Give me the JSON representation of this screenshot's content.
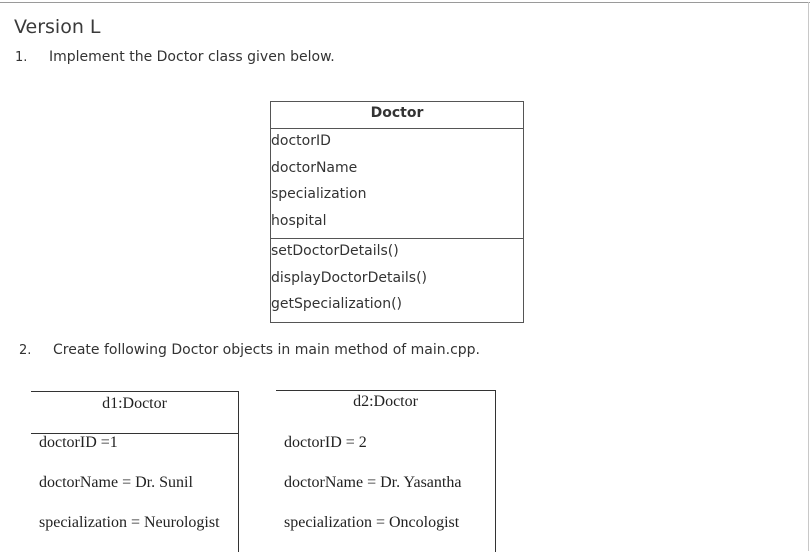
{
  "header": {
    "title": "Version L"
  },
  "questions": [
    {
      "number": "1.",
      "text": "Implement the Doctor class given below."
    },
    {
      "number": "2.",
      "text": "Create following Doctor objects in main method of main.cpp."
    }
  ],
  "uml_class": {
    "name": "Doctor",
    "attributes": [
      "doctorID",
      "doctorName",
      "specialization",
      "hospital"
    ],
    "methods": [
      "setDoctorDetails()",
      "displayDoctorDetails()",
      "getSpecialization()"
    ]
  },
  "objects": [
    {
      "title": "d1:Doctor",
      "fields": [
        "doctorID =1",
        "doctorName =  Dr. Sunil",
        "specialization = Neurologist"
      ]
    },
    {
      "title": "d2:Doctor",
      "fields": [
        "doctorID = 2",
        "doctorName = Dr. Yasantha",
        "specialization = Oncologist"
      ]
    }
  ]
}
